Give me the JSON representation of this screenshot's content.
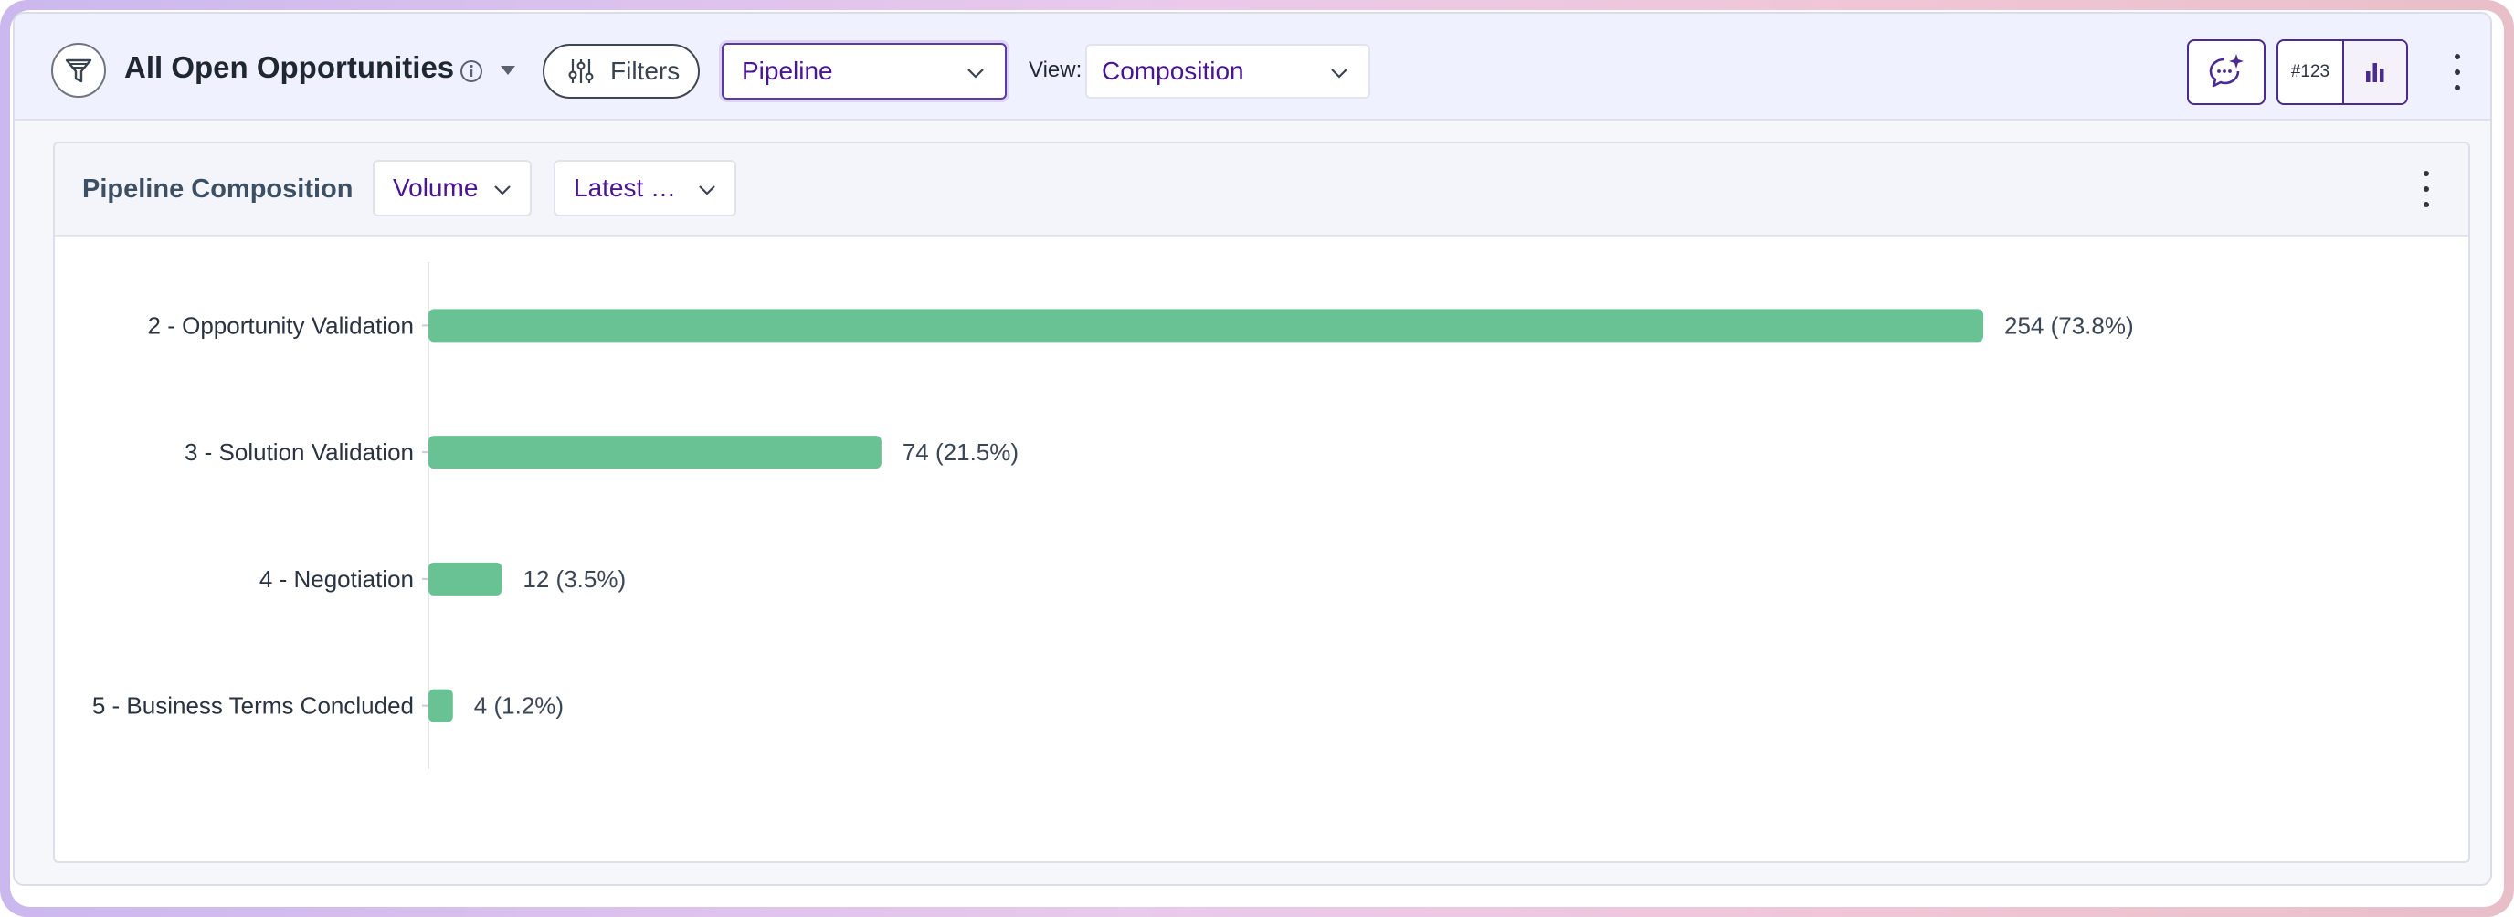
{
  "header": {
    "title": "All Open Opportunities",
    "filters_label": "Filters",
    "category_select": "Pipeline",
    "view_label": "View:",
    "view_select": "Composition",
    "count_toggle_label": "#123"
  },
  "card": {
    "title": "Pipeline Composition",
    "metric_select": "Volume",
    "period_select": "Latest …"
  },
  "colors": {
    "accent": "#4b2a92",
    "bar": "#68c293"
  },
  "icons": {
    "logo": "funnel-icon",
    "info": "info-icon",
    "title_menu": "caret-down-icon",
    "filters": "sliders-icon",
    "assistant": "chat-sparkle-icon",
    "chart_view": "bar-chart-icon",
    "more": "kebab-icon"
  },
  "chart_data": {
    "type": "bar",
    "orientation": "horizontal",
    "title": "Pipeline Composition",
    "categories": [
      "2 - Opportunity Validation",
      "3 - Solution Validation",
      "4 - Negotiation",
      "5 - Business Terms Concluded"
    ],
    "values": [
      254,
      74,
      12,
      4
    ],
    "data_labels": [
      "254 (73.8%)",
      "74 (21.5%)",
      "12 (3.5%)",
      "4 (1.2%)"
    ],
    "xlabel": "",
    "ylabel": "",
    "grid": false,
    "legend": "none"
  }
}
